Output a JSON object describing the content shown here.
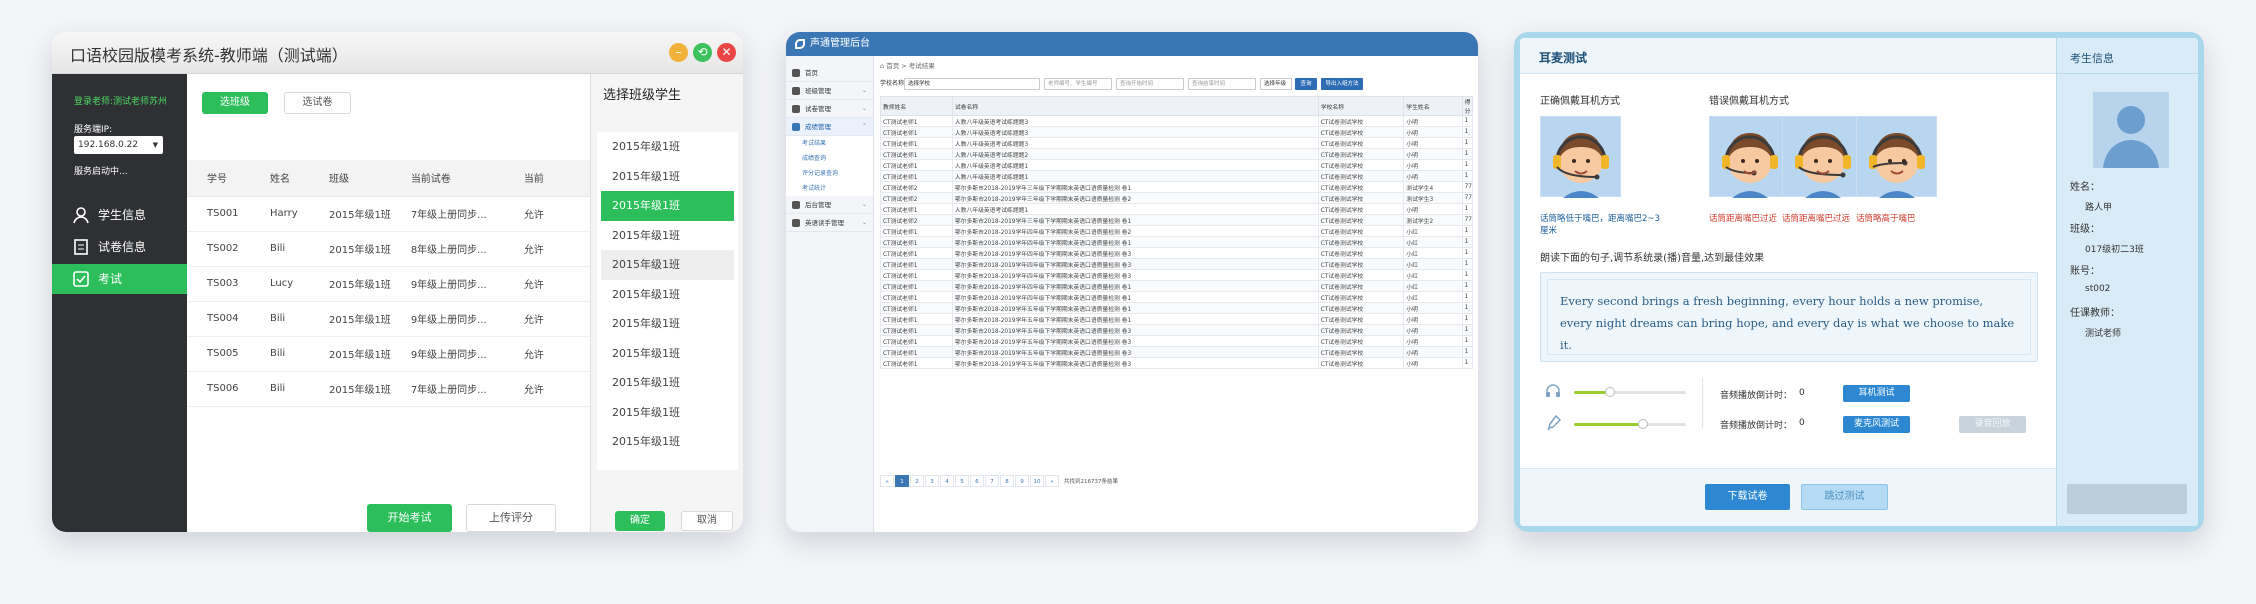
{
  "w1": {
    "title": "口语校园版模考系统-教师端（测试端）",
    "colors": {
      "accent": "#2dbe5c",
      "sidebar": "#2f3033"
    },
    "sidebar": {
      "login_text": "登录老师:测试老师苏州",
      "server_label": "服务端IP:",
      "server_ip": "192.168.0.22",
      "server_status": "服务启动中...",
      "nav": [
        {
          "label": "学生信息",
          "icon": "student-icon"
        },
        {
          "label": "试卷信息",
          "icon": "paper-icon"
        },
        {
          "label": "考试",
          "icon": "exam-icon"
        }
      ]
    },
    "buttons": {
      "select_class": "选班级",
      "select_paper": "选试卷",
      "start_exam": "开始考试",
      "upload_score": "上传评分"
    },
    "table": {
      "headers": [
        "学号",
        "姓名",
        "班级",
        "当前试卷",
        "当前"
      ],
      "rows": [
        [
          "TS001",
          "Harry",
          "2015年级1班",
          "7年级上册同步...",
          "允许"
        ],
        [
          "TS002",
          "Bili",
          "2015年级1班",
          "8年级上册同步...",
          "允许"
        ],
        [
          "TS003",
          "Lucy",
          "2015年级1班",
          "9年级上册同步...",
          "允许"
        ],
        [
          "TS004",
          "Bili",
          "2015年级1班",
          "9年级上册同步...",
          "允许"
        ],
        [
          "TS005",
          "Bili",
          "2015年级1班",
          "9年级上册同步...",
          "允许"
        ],
        [
          "TS006",
          "Bili",
          "2015年级1班",
          "7年级上册同步...",
          "允许"
        ]
      ]
    },
    "dialog": {
      "title": "选择班级学生",
      "classes": [
        "2015年级1班",
        "2015年级1班",
        "2015年级1班",
        "2015年级1班",
        "2015年级1班",
        "2015年级1班",
        "2015年级1班",
        "2015年级1班",
        "2015年级1班",
        "2015年级1班",
        "2015年级1班"
      ],
      "selected_index": 2,
      "hover_index": 4,
      "ok": "确定",
      "cancel": "取消"
    }
  },
  "w2": {
    "title": "声通管理后台",
    "colors": {
      "header": "#3a76b4"
    },
    "nav": [
      {
        "label": "首页",
        "arrow": ""
      },
      {
        "label": "班级管理",
        "arrow": "⌄"
      },
      {
        "label": "试卷管理",
        "arrow": "⌄"
      },
      {
        "label": "成绩管理",
        "arrow": "⌃"
      }
    ],
    "subnav": [
      "考试结果",
      "成绩查询",
      "评分记录查询",
      "考试统计"
    ],
    "nav2": [
      {
        "label": "后台管理",
        "arrow": "⌄"
      },
      {
        "label": "英语读手管理",
        "arrow": "⌄"
      }
    ],
    "breadcrumb": "首页 > 考试结果",
    "filters": {
      "school_label": "学校名称",
      "school_value": "选择学校",
      "teacher_ph": "老师编号、学生编号",
      "start_ph": "查询开始时间",
      "end_ph": "查询结束时间",
      "year_label": "选择年级",
      "query": "查询",
      "export": "导出入组方法"
    },
    "table": {
      "headers": [
        "教师姓名",
        "试卷名称",
        "学校名称",
        "学生姓名",
        "得分"
      ],
      "rows": [
        [
          "CT测试老师1",
          "人教八年级英语考试练题题3",
          "CT试卷测试学校",
          "小明",
          "1"
        ],
        [
          "CT测试老师1",
          "人教八年级英语考试练题题3",
          "CT试卷测试学校",
          "小明",
          "1"
        ],
        [
          "CT测试老师1",
          "人教八年级英语考试练题题3",
          "CT试卷测试学校",
          "小明",
          "1"
        ],
        [
          "CT测试老师1",
          "人教八年级英语考试练题题2",
          "CT试卷测试学校",
          "小明",
          "1"
        ],
        [
          "CT测试老师1",
          "人教八年级英语考试练题题1",
          "CT试卷测试学校",
          "小明",
          "1"
        ],
        [
          "CT测试老师1",
          "人教八年级英语考试练题题1",
          "CT试卷测试学校",
          "小明",
          "1"
        ],
        [
          "CT测试老师2",
          "鄂尔多斯市2018-2019学年三年级下学期期末英语口语质量检测 卷1",
          "CT试卷测试学校",
          "测试学生4",
          "77"
        ],
        [
          "CT测试老师2",
          "鄂尔多斯市2018-2019学年三年级下学期期末英语口语质量检测 卷2",
          "CT试卷测试学校",
          "测试学生3",
          "77"
        ],
        [
          "CT测试老师1",
          "人教八年级英语考试练题题1",
          "CT试卷测试学校",
          "小明",
          "1"
        ],
        [
          "CT测试老师2",
          "鄂尔多斯市2018-2019学年三年级下学期期末英语口语质量检测 卷1",
          "CT试卷测试学校",
          "测试学生2",
          "77"
        ],
        [
          "CT测试老师1",
          "鄂尔多斯市2018-2019学年四年级下学期期末英语口语质量检测 卷2",
          "CT试卷测试学校",
          "小红",
          "1"
        ],
        [
          "CT测试老师1",
          "鄂尔多斯市2018-2019学年四年级下学期期末英语口语质量检测 卷1",
          "CT试卷测试学校",
          "小红",
          "1"
        ],
        [
          "CT测试老师1",
          "鄂尔多斯市2018-2019学年四年级下学期期末英语口语质量检测 卷3",
          "CT试卷测试学校",
          "小红",
          "1"
        ],
        [
          "CT测试老师1",
          "鄂尔多斯市2018-2019学年四年级下学期期末英语口语质量检测 卷3",
          "CT试卷测试学校",
          "小红",
          "1"
        ],
        [
          "CT测试老师1",
          "鄂尔多斯市2018-2019学年四年级下学期期末英语口语质量检测 卷3",
          "CT试卷测试学校",
          "小红",
          "1"
        ],
        [
          "CT测试老师1",
          "鄂尔多斯市2018-2019学年四年级下学期期末英语口语质量检测 卷1",
          "CT试卷测试学校",
          "小红",
          "1"
        ],
        [
          "CT测试老师1",
          "鄂尔多斯市2018-2019学年四年级下学期期末英语口语质量检测 卷1",
          "CT试卷测试学校",
          "小红",
          "1"
        ],
        [
          "CT测试老师1",
          "鄂尔多斯市2018-2019学年五年级下学期期末英语口语质量检测 卷1",
          "CT试卷测试学校",
          "小明",
          "1"
        ],
        [
          "CT测试老师1",
          "鄂尔多斯市2018-2019学年五年级下学期期末英语口语质量检测 卷1",
          "CT试卷测试学校",
          "小明",
          "1"
        ],
        [
          "CT测试老师1",
          "鄂尔多斯市2018-2019学年五年级下学期期末英语口语质量检测 卷3",
          "CT试卷测试学校",
          "小明",
          "1"
        ],
        [
          "CT测试老师1",
          "鄂尔多斯市2018-2019学年五年级下学期期末英语口语质量检测 卷3",
          "CT试卷测试学校",
          "小明",
          "1"
        ],
        [
          "CT测试老师1",
          "鄂尔多斯市2018-2019学年五年级下学期期末英语口语质量检测 卷3",
          "CT试卷测试学校",
          "小明",
          "1"
        ],
        [
          "CT测试老师1",
          "鄂尔多斯市2018-2019学年五年级下学期期末英语口语质量检测 卷3",
          "CT试卷测试学校",
          "小明",
          "1"
        ]
      ]
    },
    "pagination": {
      "prev": "«",
      "pages": [
        "1",
        "2",
        "3",
        "4",
        "5",
        "6",
        "7",
        "8",
        "9",
        "10"
      ],
      "next": "»",
      "total": "共找到216737条结果"
    }
  },
  "w3": {
    "title": "耳麦测试",
    "right_title": "考生信息",
    "correct_label": "正确佩戴耳机方式",
    "wrong_label": "错误佩戴耳机方式",
    "captions": [
      {
        "text": "话筒略低于嘴巴，距离嘴巴2~3厘米",
        "color": "#1e5f9a"
      },
      {
        "text": "话筒距离嘴巴过近",
        "color": "#d03a2a"
      },
      {
        "text": "话筒距离嘴巴过远",
        "color": "#d03a2a"
      },
      {
        "text": "话筒略高于嘴巴",
        "color": "#d03a2a"
      }
    ],
    "instruction": "朗读下面的句子,调节系统录(播)音量,达到最佳效果",
    "sentence": "Every second brings a fresh beginning, every hour holds a new promise, every night dreams can bring hope, and every day is what we choose to make it.",
    "playback_label": "音频播放倒计时：",
    "playback_value": "0",
    "record_label": "音频播放倒计时：",
    "record_value": "0",
    "headphone_level": 0.32,
    "mic_level": 0.62,
    "buttons": {
      "headphone_test": "耳机测试",
      "mic_test": "麦克风测试",
      "replay": "录音回放",
      "download": "下载试卷",
      "skip": "跳过测试"
    },
    "student": {
      "name_label": "姓名：",
      "name": "路人甲",
      "class_label": "班级：",
      "class": "017级初二3班",
      "account_label": "账号：",
      "account": "st002",
      "teacher_label": "任课教师：",
      "teacher": "测试老师"
    },
    "colors": {
      "accent": "#2d88d1",
      "panel": "#d9ebf6"
    }
  }
}
